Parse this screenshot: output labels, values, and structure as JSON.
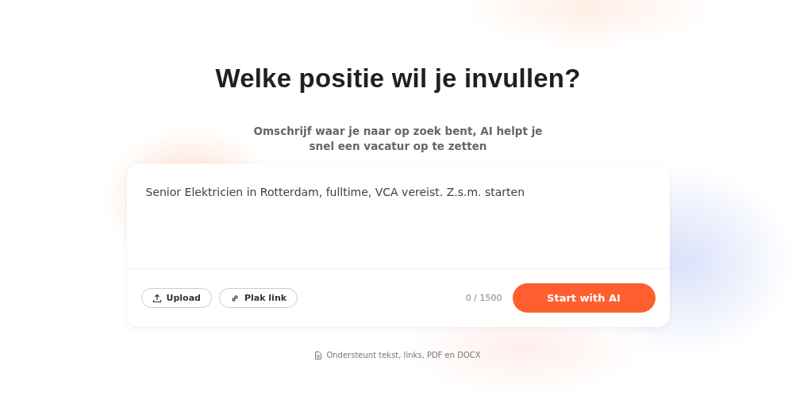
{
  "heading": "Welke positie wil je invullen?",
  "subtitle": "Omschrijf waar je naar op zoek bent, AI helpt je snel een vacatur op te zetten",
  "composer": {
    "placeholder": "Senior Elektricien in Rotterdam, fulltime, VCA vereist. Z.s.m. starten",
    "actions": [
      {
        "kind": "upload",
        "label": "Upload"
      },
      {
        "kind": "link",
        "label": "Plak link"
      }
    ],
    "counter": "0 / 1500",
    "submit": "Start with AI"
  },
  "hint": "Ondersteunt tekst, links, PDF en DOCX"
}
